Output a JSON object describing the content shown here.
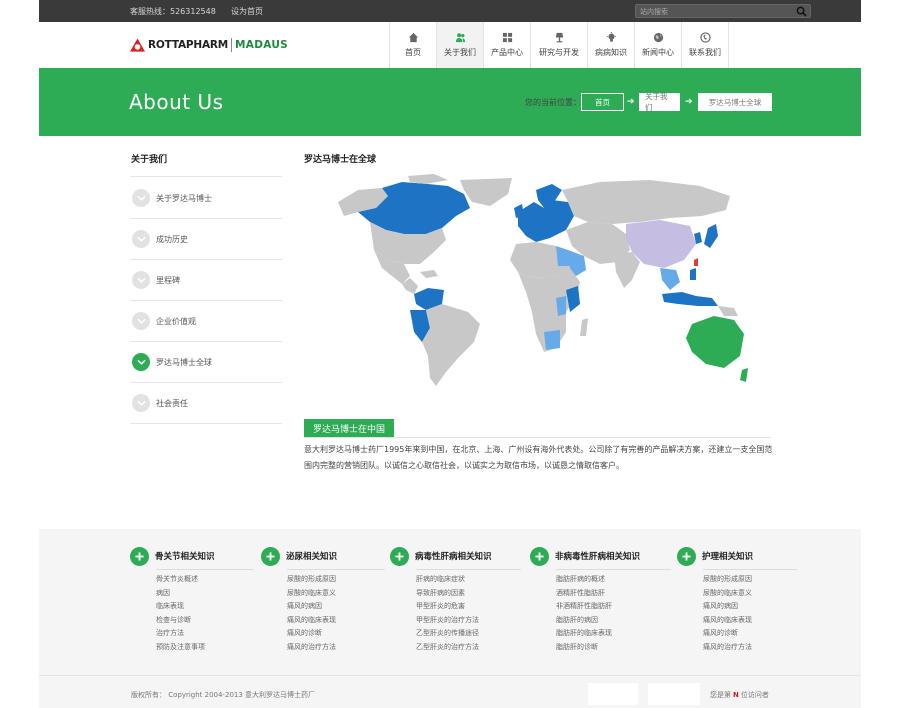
{
  "topbar": {
    "hotline": "客服热线：526312548",
    "set_home": "设为首页",
    "search_placeholder": "站内搜索"
  },
  "header": {
    "brand_primary": "ROTTAPHARM",
    "brand_secondary": "MADAUS",
    "nav": [
      {
        "label": "首页",
        "icon": "home-icon"
      },
      {
        "label": "关于我们",
        "icon": "people-icon",
        "active": true
      },
      {
        "label": "产品中心",
        "icon": "grid-icon"
      },
      {
        "label": "研究与开发",
        "icon": "lamp-icon"
      },
      {
        "label": "病病知识",
        "icon": "bulb-icon"
      },
      {
        "label": "新闻中心",
        "icon": "globe-icon"
      },
      {
        "label": "联系我们",
        "icon": "phone-icon"
      }
    ]
  },
  "banner": {
    "title": "About Us",
    "breadcrumb_label": "您的当前位置：",
    "breadcrumb": [
      "首页",
      "关于我们",
      "罗达马博士全球"
    ]
  },
  "sidebar": {
    "title": "关于我们",
    "items": [
      {
        "label": "关于罗达马博士"
      },
      {
        "label": "成功历史"
      },
      {
        "label": "里程碑"
      },
      {
        "label": "企业价值观"
      },
      {
        "label": "罗达马博士全球",
        "active": true
      },
      {
        "label": "社会责任"
      }
    ]
  },
  "main": {
    "title": "罗达马博士在全球",
    "china_label": "罗达马博士在中国",
    "china_text": "意大利罗达马博士药厂1995年来到中国，在北京、上海、广州设有海外代表处。公司除了有完善的产品解决方案，还建立一支全国范围内完整的营销团队。以诚信之心取信社会，以诚实之为取信市场，以诚恳之情取信客户。"
  },
  "colors": {
    "accent": "#2dab55",
    "map_land": "#c8c8c8",
    "map_presence": "#1d74c4",
    "map_partner": "#66aaea",
    "map_china": "#c5bde2"
  },
  "footer": {
    "columns": [
      {
        "title": "骨关节相关知识",
        "links": [
          "骨关节炎概述",
          "病因",
          "临床表现",
          "检查与诊断",
          "治疗方法",
          "预防及注意事项"
        ]
      },
      {
        "title": "泌尿相关知识",
        "links": [
          "尿酸的形成原因",
          "尿酸的临床意义",
          "痛风的病因",
          "痛风的临床表现",
          "痛风的诊断",
          "痛风的治疗方法"
        ]
      },
      {
        "title": "病毒性肝病相关知识",
        "links": [
          "肝病的临床症状",
          "导致肝病的因素",
          "甲型肝炎的危害",
          "甲型肝炎的治疗方法",
          "乙型肝炎的传播途径",
          "乙型肝炎的治疗方法"
        ]
      },
      {
        "title": "非病毒性肝病相关知识",
        "links": [
          "脂肪肝病的概述",
          "酒精肝性脂肪肝",
          "非酒精肝性脂肪肝",
          "脂肪肝的病因",
          "脂肪肝的临床表现",
          "脂肪肝的诊断"
        ]
      },
      {
        "title": "护理相关知识",
        "links": [
          "尿酸的形成原因",
          "尿酸的临床意义",
          "痛风的病因",
          "痛风的临床表现",
          "痛风的诊断",
          "痛风的治疗方法"
        ]
      }
    ],
    "copyright": "版权所有：  Copyright  2004-2013  意大利罗达马博士药厂",
    "visitor_prefix": "您是第",
    "visitor_mark": "N",
    "visitor_suffix": "位访问者"
  }
}
